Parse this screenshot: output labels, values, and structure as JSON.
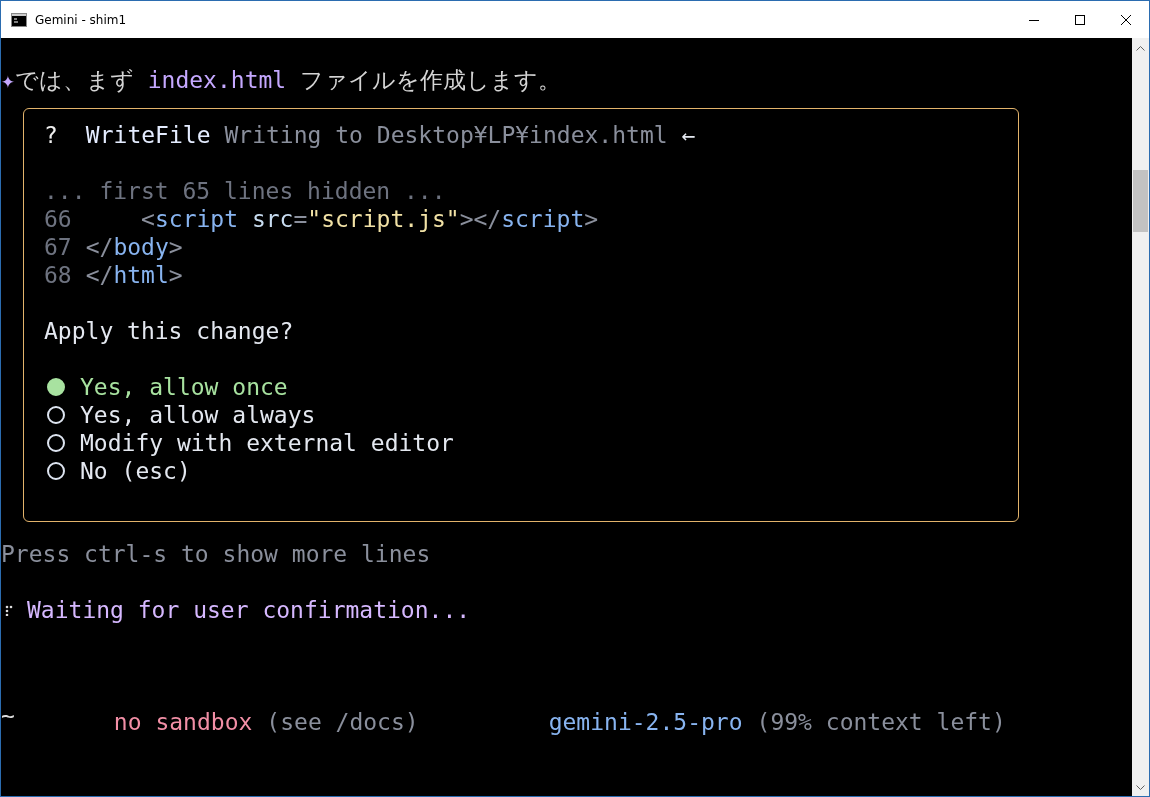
{
  "window": {
    "title": "Gemini - shim1"
  },
  "message": {
    "icon": "✦",
    "segments": [
      {
        "text": "では、まず ",
        "kind": "plain"
      },
      {
        "text": "index.html",
        "kind": "accent"
      },
      {
        "text": " ファイルを作成します。",
        "kind": "plain"
      }
    ]
  },
  "tool_dialog": {
    "status_icon": "?",
    "tool": "WriteFile",
    "description": "Writing to Desktop¥LP¥index.html",
    "arrow": "←",
    "hidden_note": "... first 65 lines hidden ...",
    "code_lines": [
      {
        "number": "66",
        "segments": [
          {
            "text": "    <",
            "kind": "punct"
          },
          {
            "text": "script",
            "kind": "tag"
          },
          {
            "text": " src",
            "kind": "attr"
          },
          {
            "text": "=",
            "kind": "punct"
          },
          {
            "text": "\"script.js\"",
            "kind": "string"
          },
          {
            "text": "></",
            "kind": "punct"
          },
          {
            "text": "script",
            "kind": "tag"
          },
          {
            "text": ">",
            "kind": "punct"
          }
        ]
      },
      {
        "number": "67",
        "segments": [
          {
            "text": "</",
            "kind": "punct"
          },
          {
            "text": "body",
            "kind": "tag"
          },
          {
            "text": ">",
            "kind": "punct"
          }
        ]
      },
      {
        "number": "68",
        "segments": [
          {
            "text": "</",
            "kind": "punct"
          },
          {
            "text": "html",
            "kind": "tag"
          },
          {
            "text": ">",
            "kind": "punct"
          }
        ]
      }
    ],
    "question": "Apply this change?",
    "options": [
      {
        "label": "Yes, allow once",
        "selected": true
      },
      {
        "label": "Yes, allow always",
        "selected": false
      },
      {
        "label": "Modify with external editor",
        "selected": false
      },
      {
        "label": "No (esc)",
        "selected": false
      }
    ]
  },
  "hint": "Press ctrl-s to show more lines",
  "status": {
    "text": "Waiting for user confirmation..."
  },
  "footer": {
    "cwd": "~",
    "sandbox": "no sandbox",
    "sandbox_note": "(see /docs)",
    "model": "gemini-2.5-pro",
    "context": "(99% context left)"
  }
}
